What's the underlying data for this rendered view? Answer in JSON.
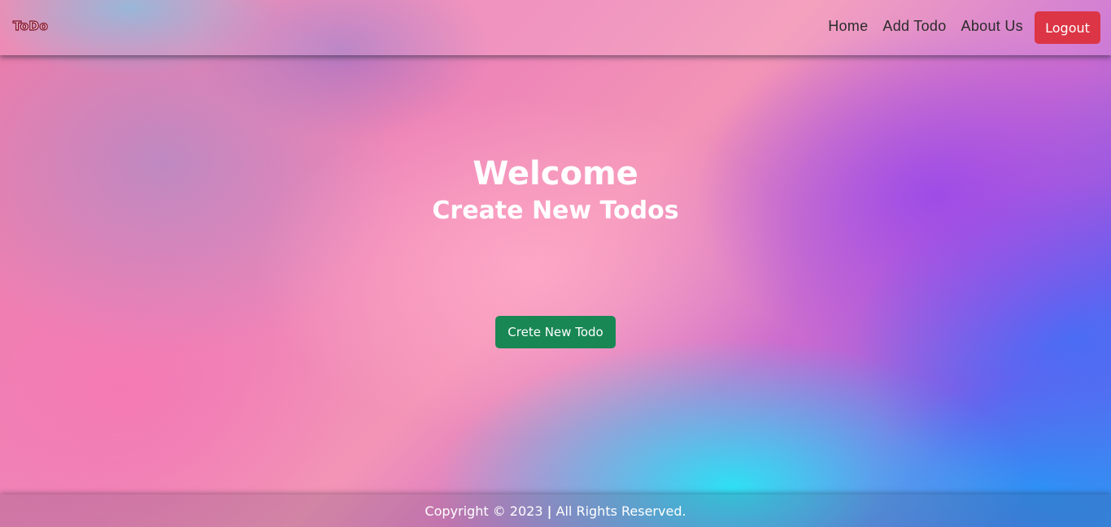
{
  "navbar": {
    "brand": "ToDo",
    "links": [
      {
        "label": "Home"
      },
      {
        "label": "Add Todo"
      },
      {
        "label": "About Us"
      }
    ],
    "logout_label": "Logout"
  },
  "hero": {
    "title": "Welcome",
    "subtitle": "Create New Todos",
    "button_label": "Crete New Todo"
  },
  "footer": {
    "copyright": "Copyright © 2023",
    "separator": "|",
    "rights": "All Rights Reserved."
  },
  "colors": {
    "logout_button": "#dc3545",
    "create_button": "#198754",
    "nav_text": "#2b2b2b",
    "hero_text": "#ffffff"
  }
}
